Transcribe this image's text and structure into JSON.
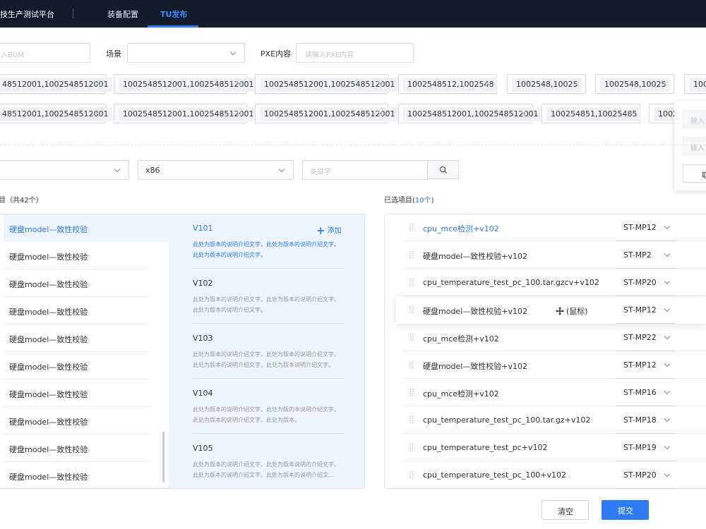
{
  "header": {
    "brand": "技生产测试平台",
    "nav": [
      {
        "label": "装备配置"
      },
      {
        "label": "TU发布"
      }
    ]
  },
  "filters": {
    "bom_placeholder": "入BOM",
    "scene_label": "场景",
    "pxe_label": "PXE内容",
    "pxe_placeholder": "请输入PXE内容"
  },
  "tags_row1": [
    "48512001,1002548512001",
    "1002548512001,1002548512001",
    "1002548512001,1002548512001",
    "1002548512,1002548",
    "1002548,10025",
    "1002548,10025",
    "1002"
  ],
  "tags_row2": [
    "48512001,1002548512001",
    "1002548512001,1002548512001",
    "1002548512001,1002548512001",
    "1002548512001,1002548512001",
    "100254851,10025485",
    "1002"
  ],
  "popup": {
    "input1_placeholder": "输入",
    "input2_placeholder": "输入",
    "button_label": "取"
  },
  "search": {
    "arch_value": "x86",
    "keyword_placeholder": "关键字"
  },
  "left": {
    "title": "目（共42个）",
    "items": [
      "硬盘model—致性校验",
      "硬盘model—致性校验",
      "硬盘model—致性校验",
      "硬盘model—致性校验",
      "硬盘model—致性校验",
      "硬盘model—致性校验",
      "硬盘model—致性校验",
      "硬盘model—致性校验",
      "硬盘model—致性校验",
      "硬盘model—致性校验"
    ],
    "add_label": "添加",
    "versions": [
      {
        "title": "V101",
        "line1": "此处为版本的说明介绍文字、此处为版本的说明介绍文字、",
        "line2": "此处为版本的说明介绍文字。"
      },
      {
        "title": "V102",
        "line1": "此处为版本的说明介绍文字、此处为版本的说明介绍文字、",
        "line2": "此处为版本的说明介绍文字。"
      },
      {
        "title": "V103",
        "line1": "此处为版本的说明介绍文字、此处为版本的说明介绍文字、",
        "line2": "此处为版本的说明介绍文字、此处为版本说明介绍文字。"
      },
      {
        "title": "V104",
        "line1": "此处为版本的说明介绍文字、此处为版的本说明介绍文字、",
        "line2": "此处为版本的说明介绍文字、此处为版本。"
      },
      {
        "title": "V105",
        "line1": "此处为版本的说明介绍文字、此处为版本说明的介绍文字、",
        "line2": "此处为版本的说明介绍文字、此处为版本的说明介绍文..."
      }
    ]
  },
  "right": {
    "title_prefix": "已选项目(",
    "count": "10个",
    "title_suffix": ")",
    "drag_hint": "(鼠标)",
    "items": [
      {
        "name": "cpu_mce检测+v102",
        "mp": "ST-MP12"
      },
      {
        "name": "硬盘model—致性校验+v102",
        "mp": "ST-MP2"
      },
      {
        "name": "cpu_temperature_test_pc_100.tar.gzcv+v102",
        "mp": "ST-MP20"
      },
      {
        "name": "硬盘model—致性校验+v102",
        "mp": "ST-MP12"
      },
      {
        "name": "cpu_mce检测+v102",
        "mp": "ST-MP22"
      },
      {
        "name": "硬盘model—致性校验+v102",
        "mp": "ST-MP12"
      },
      {
        "name": "cpu_mce检测+v102",
        "mp": "ST-MP16"
      },
      {
        "name": "cpu_temperature_test_pc_100.tar.gz+v102",
        "mp": "ST-MP18"
      },
      {
        "name": "cpu_temperature_test_pc+v102",
        "mp": "ST-MP19"
      },
      {
        "name": "cpu_temperature_test_pc_100+v102",
        "mp": "ST-MP20"
      }
    ]
  },
  "footer": {
    "clear_label": "清空",
    "submit_label": "提交"
  },
  "colors": {
    "primary": "#2f7bf5",
    "topbar": "#141b2b",
    "selected_bg": "#eef4fd"
  }
}
